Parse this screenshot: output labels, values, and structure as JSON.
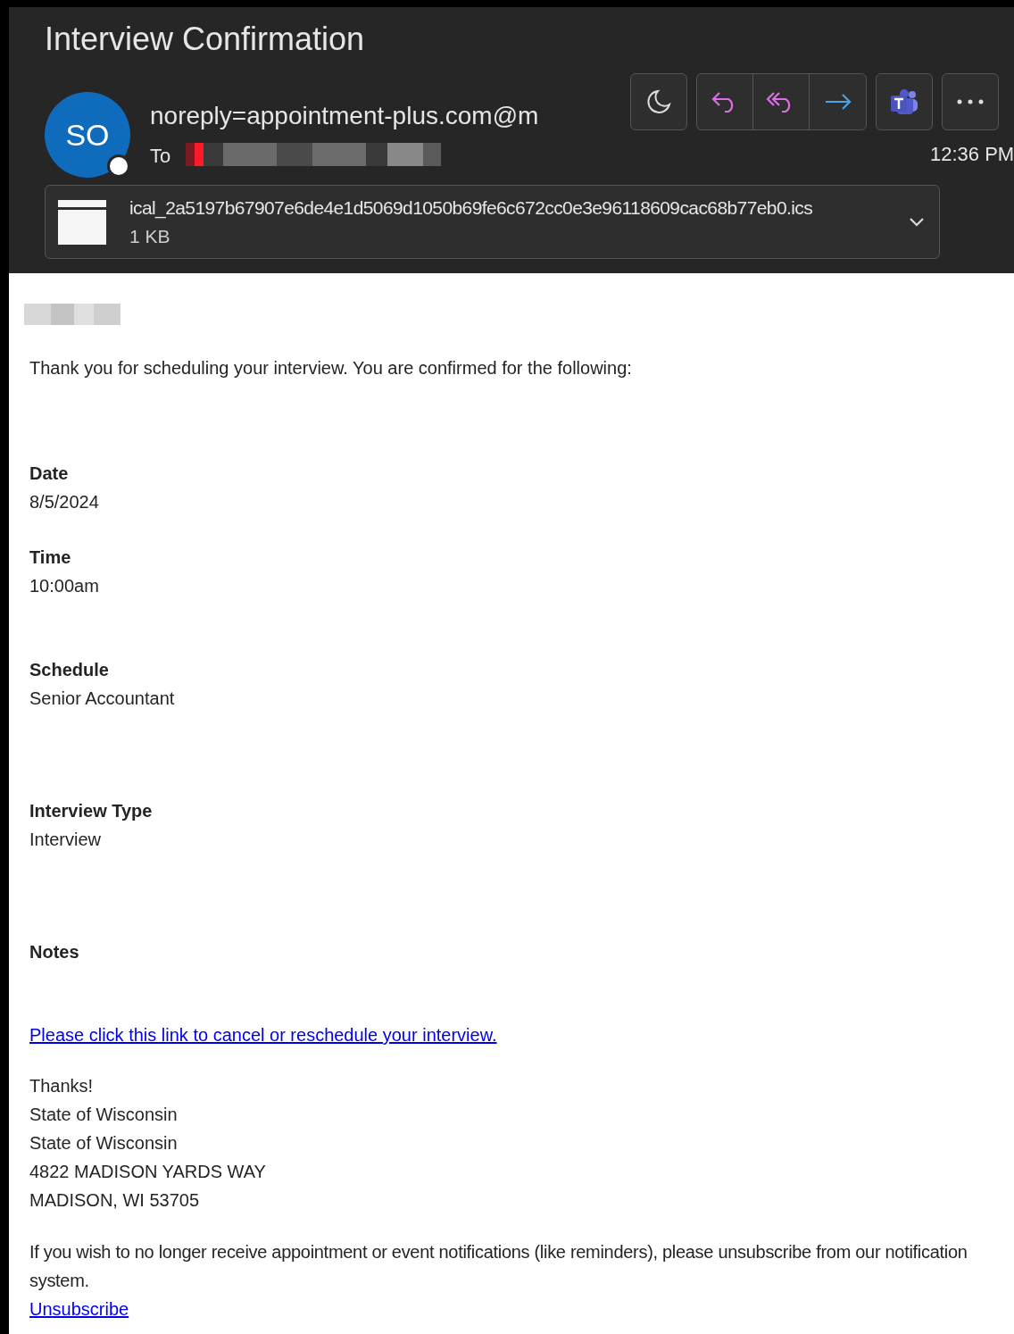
{
  "message": {
    "title": "Interview Confirmation",
    "sender_initials": "SO",
    "sender": "noreply=appointment-plus.com@m",
    "to_label": "To",
    "time": "12:36 PM"
  },
  "attachment": {
    "name": "ical_2a5197b67907e6de4e1d5069d1050b69fe6c672cc0e3e96118609cac68b77eb0.ics",
    "size": "1 KB"
  },
  "body": {
    "intro": "Thank you for scheduling your interview. You are confirmed for the following:",
    "sections": [
      {
        "label": "Date",
        "value": "8/5/2024"
      },
      {
        "label": "Time",
        "value": "10:00am"
      },
      {
        "label": "Schedule",
        "value": "Senior Accountant"
      },
      {
        "label": "Interview Type",
        "value": "Interview"
      },
      {
        "label": "Notes"
      }
    ],
    "link": "Please click this link to cancel or reschedule your interview.",
    "closing": [
      "Thanks!",
      "State of Wisconsin",
      "State of Wisconsin",
      "4822 MADISON YARDS WAY",
      "MADISON, WI 53705"
    ],
    "unsubscribe_note": "If you wish to no longer receive appointment or event notifications (like reminders), please unsubscribe from our notification system.",
    "unsubscribe_link": "Unsubscribe"
  }
}
